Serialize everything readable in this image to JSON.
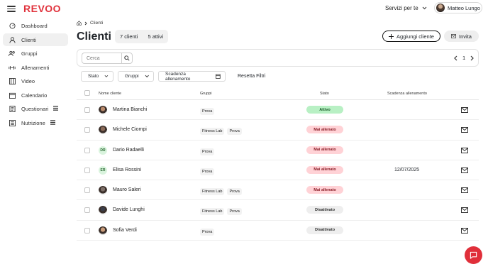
{
  "app": {
    "logo": "REVOO",
    "services_label": "Servizi per te",
    "user_name": "Matteo Lungo"
  },
  "sidebar": {
    "items": [
      {
        "label": "Dashboard",
        "icon": "dashboard-icon"
      },
      {
        "label": "Clienti",
        "icon": "user-icon",
        "active": true
      },
      {
        "label": "Gruppi",
        "icon": "groups-icon"
      },
      {
        "label": "Allenamenti",
        "icon": "dumbbell-icon"
      },
      {
        "label": "Video",
        "icon": "video-icon"
      },
      {
        "label": "Calendario",
        "icon": "calendar-icon"
      },
      {
        "label": "Questionari",
        "icon": "survey-icon",
        "badge": true
      },
      {
        "label": "Nutrizione",
        "icon": "nutrition-icon",
        "badge": true
      }
    ]
  },
  "breadcrumb": {
    "current": "Clienti"
  },
  "header": {
    "title": "Clienti",
    "total_clients": "7 clienti",
    "active_clients": "5 attivi",
    "add_label": "Aggiungi cliente",
    "invite_label": "Invita"
  },
  "search": {
    "placeholder": "Cerca"
  },
  "pagination": {
    "page": "1"
  },
  "filters": {
    "stato": "Stato",
    "gruppi": "Gruppi",
    "scadenza": "Scadenza allenamento",
    "reset": "Resetta Filtri"
  },
  "table": {
    "columns": {
      "name": "Nome cliente",
      "groups": "Gruppi",
      "status": "Stato",
      "deadline": "Scadenza allenamento"
    },
    "rows": [
      {
        "name": "Martina Bianchi",
        "avatar": "photo",
        "groups": [
          "Prova"
        ],
        "status": "Attivo",
        "status_color": "#b8f0c4",
        "deadline": ""
      },
      {
        "name": "Michele Ciompi",
        "avatar": "photo",
        "groups": [
          "Fitness Lab",
          "Prova"
        ],
        "status": "Mai allenato",
        "status_color": "#ffd2d6",
        "deadline": ""
      },
      {
        "name": "Dario Radaelli",
        "avatar": "DR",
        "groups": [
          "Prova"
        ],
        "status": "Mai allenato",
        "status_color": "#ffd2d6",
        "deadline": ""
      },
      {
        "name": "Elisa Rossini",
        "avatar": "ER",
        "groups": [
          "Prova"
        ],
        "status": "Mai allenato",
        "status_color": "#ffd2d6",
        "deadline": "12/07/2025"
      },
      {
        "name": "Mauro Saleri",
        "avatar": "photo",
        "groups": [
          "Fitness Lab",
          "Prova"
        ],
        "status": "Mai allenato",
        "status_color": "#ffd2d6",
        "deadline": ""
      },
      {
        "name": "Davide Lunghi",
        "avatar": "photo",
        "groups": [
          "Fitness Lab",
          "Prova"
        ],
        "status": "Disattivato",
        "status_color": "#eeeeee",
        "deadline": ""
      },
      {
        "name": "Sofia Verdi",
        "avatar": "photo",
        "groups": [
          "Prova"
        ],
        "status": "Disattivato",
        "status_color": "#eeeeee",
        "deadline": ""
      }
    ]
  },
  "colors": {
    "brand": "#e0313b",
    "chat_button": "#e02f3a"
  }
}
